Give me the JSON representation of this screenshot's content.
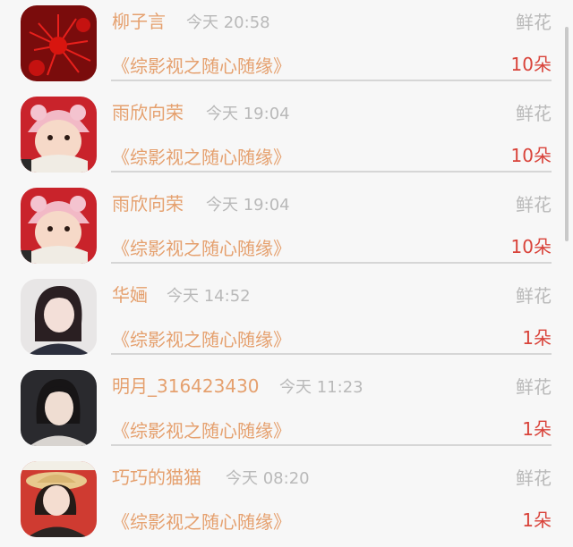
{
  "rows": [
    {
      "name": "柳子言",
      "time": "今天 20:58",
      "gift": "鲜花",
      "book": "《综影视之随心随缘》",
      "count": "10朵",
      "avatar": "red-spider-lily-photo"
    },
    {
      "name": "雨欣向荣",
      "time": "今天 19:04",
      "gift": "鲜花",
      "book": "《综影视之随心随缘》",
      "count": "10朵",
      "avatar": "baby-in-pink-hat-photo"
    },
    {
      "name": "雨欣向荣",
      "time": "今天 19:04",
      "gift": "鲜花",
      "book": "《综影视之随心随缘》",
      "count": "10朵",
      "avatar": "baby-in-pink-hat-photo"
    },
    {
      "name": "华婳",
      "time": "今天 14:52",
      "gift": "鲜花",
      "book": "《综影视之随心随缘》",
      "count": "1朵",
      "avatar": "girl-portrait-photo"
    },
    {
      "name": "明月_316423430",
      "time": "今天 11:23",
      "gift": "鲜花",
      "book": "《综影视之随心随缘》",
      "count": "1朵",
      "avatar": "woman-portrait-photo"
    },
    {
      "name": "巧巧的猫猫",
      "time": "今天 08:20",
      "gift": "鲜花",
      "book": "《综影视之随心随缘》",
      "count": "1朵",
      "avatar": "girl-straw-hat-photo"
    }
  ],
  "colors": {
    "name": "#e5a06e",
    "book": "#e5a06e",
    "count": "#d9433a",
    "muted": "#b9b9b9",
    "background": "#f7f7f7"
  }
}
